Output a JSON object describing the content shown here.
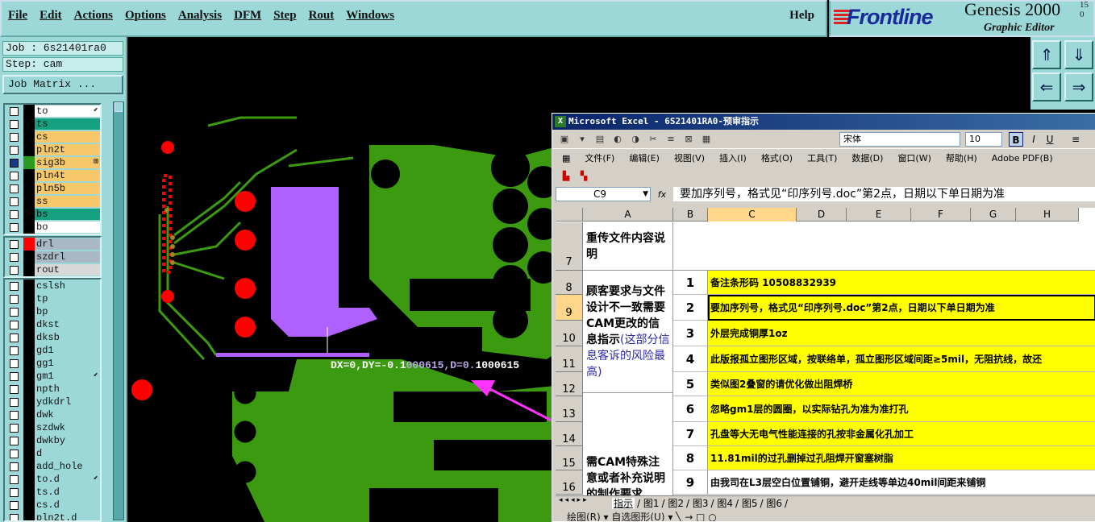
{
  "menubar": {
    "items": [
      "File",
      "Edit",
      "Actions",
      "Options",
      "Analysis",
      "DFM",
      "Step",
      "Rout",
      "Windows"
    ],
    "help": "Help"
  },
  "brand": {
    "logo": "Frontline",
    "product": "Genesis 2000",
    "version_a": "15",
    "version_b": "0",
    "subtitle": "Graphic Editor"
  },
  "left": {
    "job": "Job : 6s21401ra0",
    "step": "Step: cam",
    "job_matrix": "Job Matrix ...",
    "group1": [
      {
        "name": "to",
        "color": "#ffffff",
        "selected": false,
        "mark": "⬋"
      },
      {
        "name": "ts",
        "color": "#15a080",
        "selected": false,
        "mark": ""
      },
      {
        "name": "cs",
        "color": "#f6c86a",
        "selected": false,
        "mark": ""
      },
      {
        "name": "pln2t",
        "color": "#f6c86a",
        "selected": false,
        "mark": ""
      },
      {
        "name": "sig3b",
        "color": "#f6c86a",
        "selected": true,
        "mark": "⊞"
      },
      {
        "name": "pln4t",
        "color": "#f6c86a",
        "selected": false,
        "mark": ""
      },
      {
        "name": "pln5b",
        "color": "#f6c86a",
        "selected": false,
        "mark": ""
      },
      {
        "name": "ss",
        "color": "#f6c86a",
        "selected": false,
        "mark": ""
      },
      {
        "name": "bs",
        "color": "#15a080",
        "selected": false,
        "mark": ""
      },
      {
        "name": "bo",
        "color": "#ffffff",
        "selected": false,
        "mark": ""
      }
    ],
    "group2": [
      {
        "name": "drl",
        "color": "#a8b8c4",
        "selected": false,
        "mark": ""
      },
      {
        "name": "szdrl",
        "color": "#a8b8c4",
        "selected": false,
        "mark": ""
      },
      {
        "name": "rout",
        "color": "#d8d8d8",
        "selected": false,
        "mark": ""
      }
    ],
    "group3": [
      {
        "name": "cslsh",
        "mark": ""
      },
      {
        "name": "tp",
        "mark": ""
      },
      {
        "name": "bp",
        "mark": ""
      },
      {
        "name": "dkst",
        "mark": ""
      },
      {
        "name": "dksb",
        "mark": ""
      },
      {
        "name": "gd1",
        "mark": ""
      },
      {
        "name": "gg1",
        "mark": ""
      },
      {
        "name": "gm1",
        "mark": "⬋"
      },
      {
        "name": "npth",
        "mark": ""
      },
      {
        "name": "ydkdrl",
        "mark": ""
      },
      {
        "name": "dwk",
        "mark": ""
      },
      {
        "name": "szdwk",
        "mark": ""
      },
      {
        "name": "dwkby",
        "mark": ""
      },
      {
        "name": "d",
        "mark": ""
      },
      {
        "name": "add_hole",
        "mark": ""
      },
      {
        "name": "to.d",
        "mark": "⬋"
      },
      {
        "name": "ts.d",
        "mark": ""
      },
      {
        "name": "cs.d",
        "mark": ""
      },
      {
        "name": "pln2t.d",
        "mark": ""
      }
    ]
  },
  "readout": {
    "main": "DX=0,DY=-0.1",
    "dim": "000615,D=0.",
    "tail": "1000615"
  },
  "excel": {
    "title": "Microsoft Excel - 6S21401RA0-预审指示",
    "font": "宋体",
    "size": "10",
    "menu": [
      "文件(F)",
      "编辑(E)",
      "视图(V)",
      "插入(I)",
      "格式(O)",
      "工具(T)",
      "数据(D)",
      "窗口(W)",
      "帮助(H)",
      "Adobe PDF(B)"
    ],
    "cellref": "C9",
    "fx": "fx",
    "formula": "要加序列号，格式见“印序列号.doc”第2点，日期以下单日期为准",
    "columns": [
      "A",
      "B",
      "C",
      "D",
      "E",
      "F",
      "G",
      "H"
    ],
    "section_a": "重传文件内容说明",
    "section_b_bold": "顾客要求与文件设计不一致需要CAM更改的信息指示",
    "section_b_blue": "(这部分信息客诉的风险最高)",
    "section_c": "需CAM特殊注意或者补充说明的制作要求",
    "rows": [
      {
        "row": "8",
        "num": "1",
        "text": "备注条形码  10508832939"
      },
      {
        "row": "9",
        "num": "2",
        "text": "要加序列号，格式见“印序列号.doc”第2点，日期以下单日期为准"
      },
      {
        "row": "10",
        "num": "3",
        "text": "外层完成铜厚1oz"
      },
      {
        "row": "11",
        "num": "4",
        "text": "此版报孤立图形区域，按联络单，孤立图形区域间距≥5mil，无阻抗线，故还"
      },
      {
        "row": "12",
        "num": "5",
        "text": "类似图2叠窗的请优化做出阻焊桥"
      },
      {
        "row": "13",
        "num": "6",
        "text": "忽略gm1层的圆圈，以实际钻孔为准为准打孔"
      },
      {
        "row": "14",
        "num": "7",
        "text": "孔盘等大无电气性能连接的孔按非金属化孔加工"
      },
      {
        "row": "15",
        "num": "8",
        "text": "11.81mil的过孔删掉过孔阻焊开窗塞树脂"
      },
      {
        "row": "16",
        "num": "9",
        "text": "由我司在L3层空白位置铺铜，避开走线等单边40mil间距来铺铜"
      }
    ],
    "row7": "7",
    "sheets": [
      "指示",
      "图1",
      "图2",
      "图3",
      "图4",
      "图5",
      "图6"
    ],
    "drawbar": "绘图(R) ▾   自选图形(U) ▾   ╲  →  □  ○"
  },
  "colors": {
    "panel": "#9cd8d8",
    "board_green": "#3c9a10",
    "pad_red": "#ff0000",
    "highlight_violet": "#b060ff",
    "arrow_magenta": "#ff33ff"
  }
}
